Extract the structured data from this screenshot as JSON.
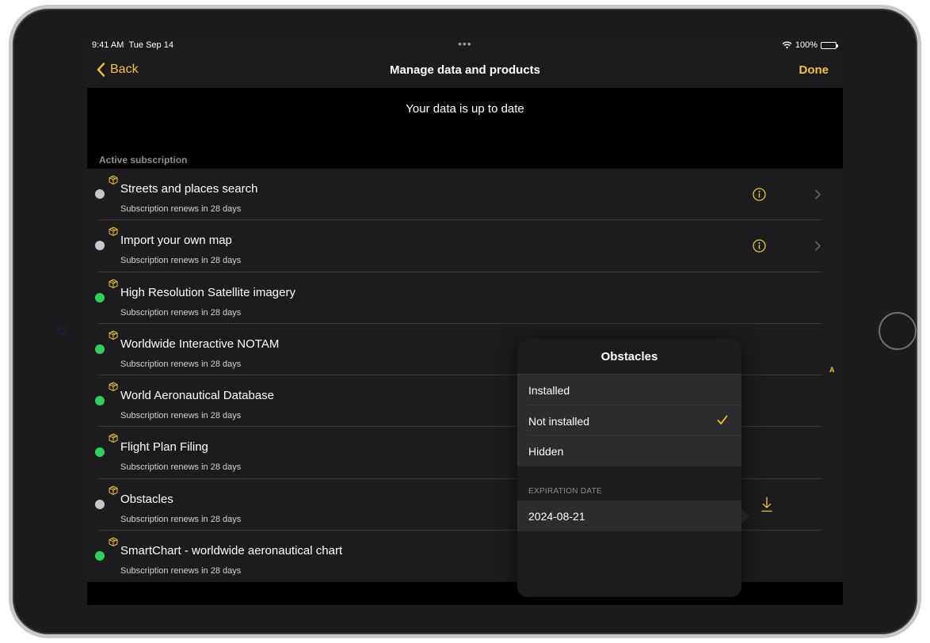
{
  "status_bar": {
    "time": "9:41 AM",
    "date": "Tue Sep 14",
    "battery": "100%"
  },
  "nav": {
    "back_label": "Back",
    "title": "Manage data and products",
    "done_label": "Done"
  },
  "status_message": "Your data is up to date",
  "section_header": "Active subscription",
  "products": [
    {
      "title": "Streets and places search",
      "subtitle": "Subscription renews in 28 days",
      "status": "gray",
      "info": true,
      "chevron": true
    },
    {
      "title": "Import your own map",
      "subtitle": "Subscription renews in 28 days",
      "status": "gray",
      "info": true,
      "chevron": true
    },
    {
      "title": "High Resolution Satellite imagery",
      "subtitle": "Subscription renews in 28 days",
      "status": "green"
    },
    {
      "title": "Worldwide Interactive NOTAM",
      "subtitle": "Subscription renews in 28 days",
      "status": "green"
    },
    {
      "title": "World Aeronautical Database",
      "subtitle": "Subscription renews in 28 days",
      "status": "green"
    },
    {
      "title": "Flight Plan Filing",
      "subtitle": "Subscription renews in 28 days",
      "status": "green"
    },
    {
      "title": "Obstacles",
      "subtitle": "Subscription renews in 28 days",
      "status": "gray",
      "download": true
    },
    {
      "title": "SmartChart - worldwide aeronautical chart",
      "subtitle": "Subscription renews in 28 days",
      "status": "green"
    }
  ],
  "side_letter": "A",
  "popover": {
    "title": "Obstacles",
    "options": [
      {
        "label": "Installed",
        "selected": false
      },
      {
        "label": "Not installed",
        "selected": true
      },
      {
        "label": "Hidden",
        "selected": false
      }
    ],
    "expiration_header": "EXPIRATION DATE",
    "expiration_value": "2024-08-21"
  },
  "colors": {
    "accent": "#f2c230",
    "status_green": "#30d158",
    "status_gray": "#c7c7cc",
    "background": "#000000",
    "cell": "#1c1c1e"
  },
  "icons": {
    "back": "chevron-left-icon",
    "info": "info-circle-icon",
    "package": "package-icon",
    "download": "download-icon",
    "check": "checkmark-icon"
  }
}
